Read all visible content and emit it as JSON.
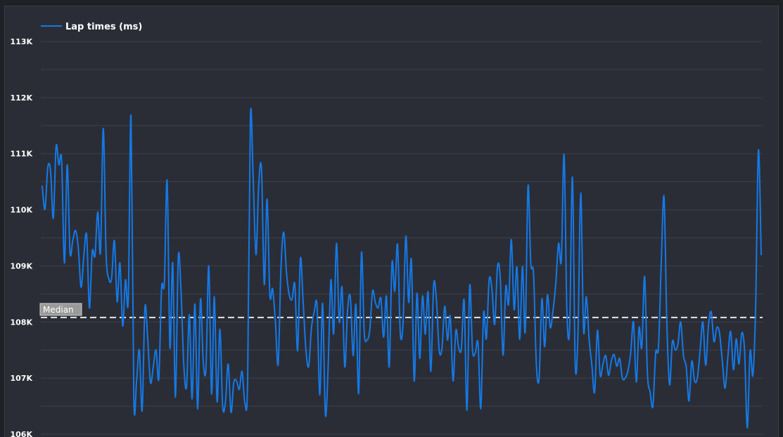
{
  "chart_data": {
    "type": "line",
    "legend": {
      "position": "top-left",
      "label": "Lap times (ms)"
    },
    "ylim": [
      106000,
      113000
    ],
    "yticks": [
      {
        "value": 106000,
        "label": "106K"
      },
      {
        "value": 107000,
        "label": "107K"
      },
      {
        "value": 108000,
        "label": "108K"
      },
      {
        "value": 109000,
        "label": "109K"
      },
      {
        "value": 110000,
        "label": "110K"
      },
      {
        "value": 111000,
        "label": "111K"
      },
      {
        "value": 112000,
        "label": "112K"
      },
      {
        "value": 113000,
        "label": "113K"
      }
    ],
    "grid": true,
    "median": {
      "label": "Median",
      "value": 108080
    },
    "series": [
      {
        "name": "Lap times (ms)",
        "color": "#1479e6",
        "values": [
          110420,
          110010,
          110750,
          110700,
          109850,
          111130,
          110800,
          110880,
          109050,
          110800,
          109250,
          109450,
          109630,
          109320,
          108620,
          109180,
          109550,
          108250,
          109250,
          109180,
          109960,
          109250,
          111450,
          109230,
          108770,
          108780,
          109450,
          108360,
          109050,
          107930,
          108750,
          108400,
          111670,
          106650,
          106950,
          107500,
          106420,
          108260,
          107700,
          106920,
          107200,
          107500,
          106990,
          108600,
          108700,
          110520,
          107550,
          109050,
          106660,
          109150,
          108560,
          107240,
          106850,
          108130,
          106630,
          108320,
          106450,
          108400,
          107300,
          107180,
          109000,
          106720,
          108450,
          106580,
          107870,
          106500,
          106570,
          107250,
          106390,
          106920,
          106950,
          106800,
          107120,
          106560,
          106950,
          111650,
          110550,
          109200,
          110450,
          110720,
          108670,
          110190,
          108490,
          108590,
          108000,
          107250,
          108950,
          109600,
          108880,
          108480,
          108400,
          108670,
          107490,
          109130,
          108350,
          107500,
          107210,
          107900,
          108180,
          108290,
          106700,
          108330,
          106350,
          107200,
          108750,
          107790,
          109400,
          108000,
          108620,
          107200,
          108210,
          108440,
          107400,
          108310,
          106730,
          109230,
          107820,
          107680,
          107860,
          108550,
          108350,
          108250,
          108420,
          107730,
          108460,
          107200,
          109050,
          108550,
          109380,
          107800,
          108000,
          109530,
          108350,
          109100,
          106950,
          108510,
          107350,
          108460,
          107780,
          108530,
          107120,
          108660,
          108400,
          107500,
          107530,
          108280,
          107680,
          108100,
          106950,
          107850,
          107540,
          107530,
          108380,
          106430,
          108650,
          107500,
          107450,
          107620,
          106460,
          108160,
          107700,
          108750,
          108590,
          107960,
          108980,
          108790,
          107410,
          108630,
          108320,
          109470,
          108220,
          108980,
          107690,
          108990,
          107830,
          110420,
          109050,
          108850,
          107250,
          107000,
          108410,
          107560,
          108480,
          107900,
          108200,
          108680,
          109400,
          109100,
          110980,
          108200,
          107900,
          110580,
          107250,
          107800,
          110300,
          107850,
          108450,
          107700,
          107230,
          106750,
          107850,
          107050,
          107250,
          107400,
          107050,
          107300,
          107420,
          107210,
          107350,
          107000,
          107000,
          107130,
          107450,
          108000,
          106930,
          107900,
          107550,
          108810,
          107100,
          106750,
          106500,
          107450,
          107550,
          109050,
          110230,
          108000,
          106880,
          107650,
          107500,
          107600,
          108000,
          107400,
          107200,
          106590,
          107300,
          106950,
          107000,
          107500,
          108000,
          107230,
          107930,
          108180,
          107650,
          107900,
          107800,
          107300,
          106820,
          107380,
          107830,
          107150,
          107700,
          107250,
          107800,
          107500,
          106110,
          107480,
          107050,
          108270,
          111060,
          109200
        ]
      }
    ]
  }
}
